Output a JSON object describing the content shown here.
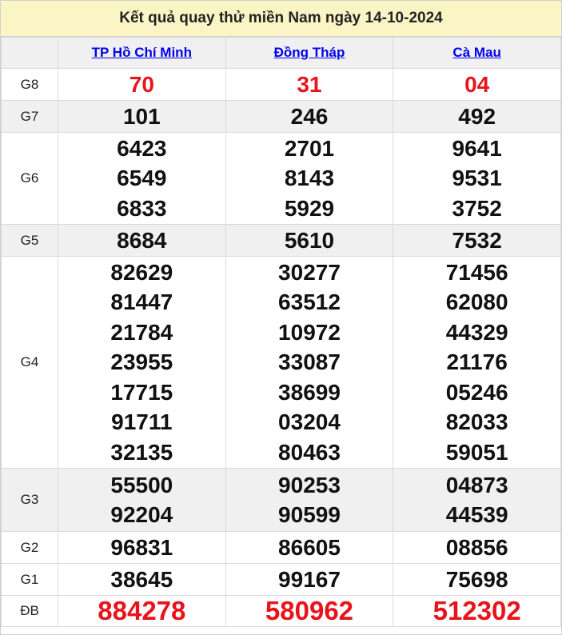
{
  "title": "Kết quả quay thử miền Nam ngày 14-10-2024",
  "provinces": [
    "TP Hồ Chí Minh",
    "Đồng Tháp",
    "Cà Mau"
  ],
  "prizes": [
    {
      "label": "G8",
      "values": [
        [
          "70"
        ],
        [
          "31"
        ],
        [
          "04"
        ]
      ]
    },
    {
      "label": "G7",
      "values": [
        [
          "101"
        ],
        [
          "246"
        ],
        [
          "492"
        ]
      ]
    },
    {
      "label": "G6",
      "values": [
        [
          "6423",
          "6549",
          "6833"
        ],
        [
          "2701",
          "8143",
          "5929"
        ],
        [
          "9641",
          "9531",
          "3752"
        ]
      ]
    },
    {
      "label": "G5",
      "values": [
        [
          "8684"
        ],
        [
          "5610"
        ],
        [
          "7532"
        ]
      ]
    },
    {
      "label": "G4",
      "values": [
        [
          "82629",
          "81447",
          "21784",
          "23955",
          "17715",
          "91711",
          "32135"
        ],
        [
          "30277",
          "63512",
          "10972",
          "33087",
          "38699",
          "03204",
          "80463"
        ],
        [
          "71456",
          "62080",
          "44329",
          "21176",
          "05246",
          "82033",
          "59051"
        ]
      ]
    },
    {
      "label": "G3",
      "values": [
        [
          "55500",
          "92204"
        ],
        [
          "90253",
          "90599"
        ],
        [
          "04873",
          "44539"
        ]
      ]
    },
    {
      "label": "G2",
      "values": [
        [
          "96831"
        ],
        [
          "86605"
        ],
        [
          "08856"
        ]
      ]
    },
    {
      "label": "G1",
      "values": [
        [
          "38645"
        ],
        [
          "99167"
        ],
        [
          "75698"
        ]
      ]
    },
    {
      "label": "ĐB",
      "values": [
        [
          "884278"
        ],
        [
          "580962"
        ],
        [
          "512302"
        ]
      ]
    }
  ],
  "colors": {
    "title_bg": "#fbf5c6",
    "highlight_red": "#e8141b",
    "link_blue": "#0000ee",
    "alt_row_bg": "#f0f0f0"
  }
}
